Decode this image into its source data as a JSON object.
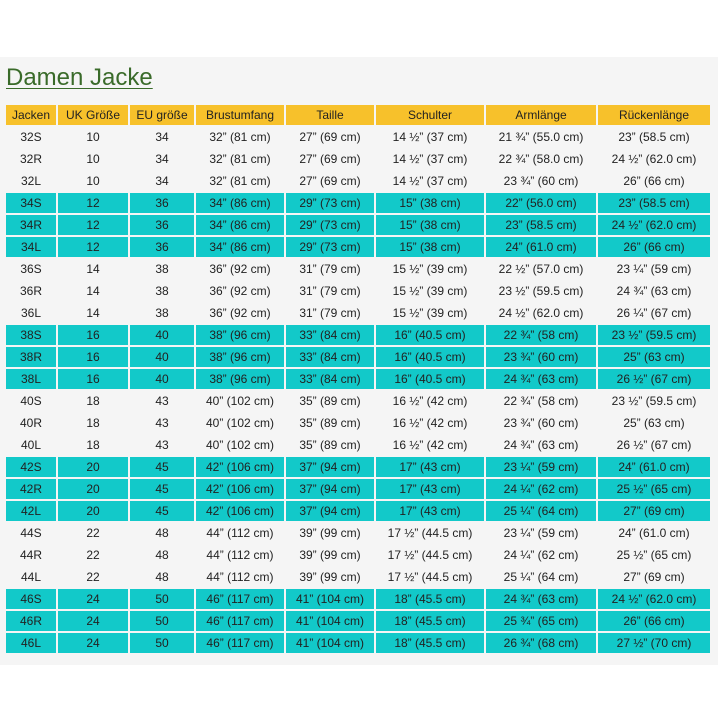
{
  "page": {
    "title": "Damen Jacke"
  },
  "colors": {
    "header_bg": "#f7c12b",
    "group_bg": "#12c9c9",
    "title_link": "#3a6b2a",
    "panel_bg": "#f5f5f5"
  },
  "table": {
    "headers": [
      "Jacken",
      "UK Größe",
      "EU größe",
      "Brustumfang",
      "Taille",
      "Schulter",
      "Armlänge",
      "Rückenlänge"
    ],
    "rows": [
      [
        "32S",
        "10",
        "34",
        "32” (81 cm)",
        "27” (69 cm)",
        "14 ½” (37 cm)",
        "21 ¾” (55.0 cm)",
        "23” (58.5 cm)"
      ],
      [
        "32R",
        "10",
        "34",
        "32” (81 cm)",
        "27” (69 cm)",
        "14 ½” (37 cm)",
        "22 ¾” (58.0 cm)",
        "24 ½” (62.0 cm)"
      ],
      [
        "32L",
        "10",
        "34",
        "32” (81 cm)",
        "27” (69 cm)",
        "14 ½” (37 cm)",
        "23 ¾” (60 cm)",
        "26” (66 cm)"
      ],
      [
        "34S",
        "12",
        "36",
        "34” (86 cm)",
        "29” (73 cm)",
        "15” (38 cm)",
        "22” (56.0 cm)",
        "23” (58.5 cm)"
      ],
      [
        "34R",
        "12",
        "36",
        "34” (86 cm)",
        "29” (73 cm)",
        "15” (38 cm)",
        "23” (58.5 cm)",
        "24 ½” (62.0 cm)"
      ],
      [
        "34L",
        "12",
        "36",
        "34” (86 cm)",
        "29” (73 cm)",
        "15” (38 cm)",
        "24” (61.0 cm)",
        "26” (66 cm)"
      ],
      [
        "36S",
        "14",
        "38",
        "36” (92 cm)",
        "31” (79 cm)",
        "15 ½” (39 cm)",
        "22 ½” (57.0 cm)",
        "23 ¼” (59 cm)"
      ],
      [
        "36R",
        "14",
        "38",
        "36” (92 cm)",
        "31” (79 cm)",
        "15 ½” (39 cm)",
        "23 ½” (59.5 cm)",
        "24 ¾” (63 cm)"
      ],
      [
        "36L",
        "14",
        "38",
        "36” (92 cm)",
        "31” (79 cm)",
        "15 ½” (39 cm)",
        "24 ½” (62.0 cm)",
        "26 ¼” (67 cm)"
      ],
      [
        "38S",
        "16",
        "40",
        "38” (96 cm)",
        "33” (84 cm)",
        "16” (40.5 cm)",
        "22 ¾” (58 cm)",
        "23 ½” (59.5 cm)"
      ],
      [
        "38R",
        "16",
        "40",
        "38” (96 cm)",
        "33” (84 cm)",
        "16” (40.5 cm)",
        "23 ¾” (60 cm)",
        "25” (63 cm)"
      ],
      [
        "38L",
        "16",
        "40",
        "38” (96 cm)",
        "33” (84 cm)",
        "16” (40.5 cm)",
        "24 ¾” (63 cm)",
        "26 ½” (67 cm)"
      ],
      [
        "40S",
        "18",
        "43",
        "40” (102 cm)",
        "35” (89 cm)",
        "16 ½” (42 cm)",
        "22 ¾” (58 cm)",
        "23 ½” (59.5 cm)"
      ],
      [
        "40R",
        "18",
        "43",
        "40” (102 cm)",
        "35” (89 cm)",
        "16 ½” (42 cm)",
        "23 ¾” (60 cm)",
        "25” (63 cm)"
      ],
      [
        "40L",
        "18",
        "43",
        "40” (102 cm)",
        "35” (89 cm)",
        "16 ½” (42 cm)",
        "24 ¾” (63 cm)",
        "26 ½” (67 cm)"
      ],
      [
        "42S",
        "20",
        "45",
        "42” (106 cm)",
        "37” (94 cm)",
        "17” (43 cm)",
        "23 ¼” (59 cm)",
        "24” (61.0 cm)"
      ],
      [
        "42R",
        "20",
        "45",
        "42” (106 cm)",
        "37” (94 cm)",
        "17” (43 cm)",
        "24 ¼” (62 cm)",
        "25 ½” (65 cm)"
      ],
      [
        "42L",
        "20",
        "45",
        "42” (106 cm)",
        "37” (94 cm)",
        "17” (43 cm)",
        "25 ¼” (64 cm)",
        "27” (69 cm)"
      ],
      [
        "44S",
        "22",
        "48",
        "44” (112 cm)",
        "39” (99 cm)",
        "17 ½” (44.5 cm)",
        "23 ¼” (59 cm)",
        "24” (61.0 cm)"
      ],
      [
        "44R",
        "22",
        "48",
        "44” (112 cm)",
        "39” (99 cm)",
        "17 ½” (44.5 cm)",
        "24 ¼” (62 cm)",
        "25 ½” (65 cm)"
      ],
      [
        "44L",
        "22",
        "48",
        "44” (112 cm)",
        "39” (99 cm)",
        "17 ½” (44.5 cm)",
        "25 ¼” (64 cm)",
        "27” (69 cm)"
      ],
      [
        "46S",
        "24",
        "50",
        "46” (117 cm)",
        "41” (104 cm)",
        "18” (45.5 cm)",
        "24 ¾” (63 cm)",
        "24 ½” (62.0 cm)"
      ],
      [
        "46R",
        "24",
        "50",
        "46” (117 cm)",
        "41” (104 cm)",
        "18” (45.5 cm)",
        "25 ¾” (65 cm)",
        "26” (66 cm)"
      ],
      [
        "46L",
        "24",
        "50",
        "46” (117 cm)",
        "41” (104 cm)",
        "18” (45.5 cm)",
        "26 ¾” (68 cm)",
        "27 ½” (70 cm)"
      ]
    ]
  }
}
